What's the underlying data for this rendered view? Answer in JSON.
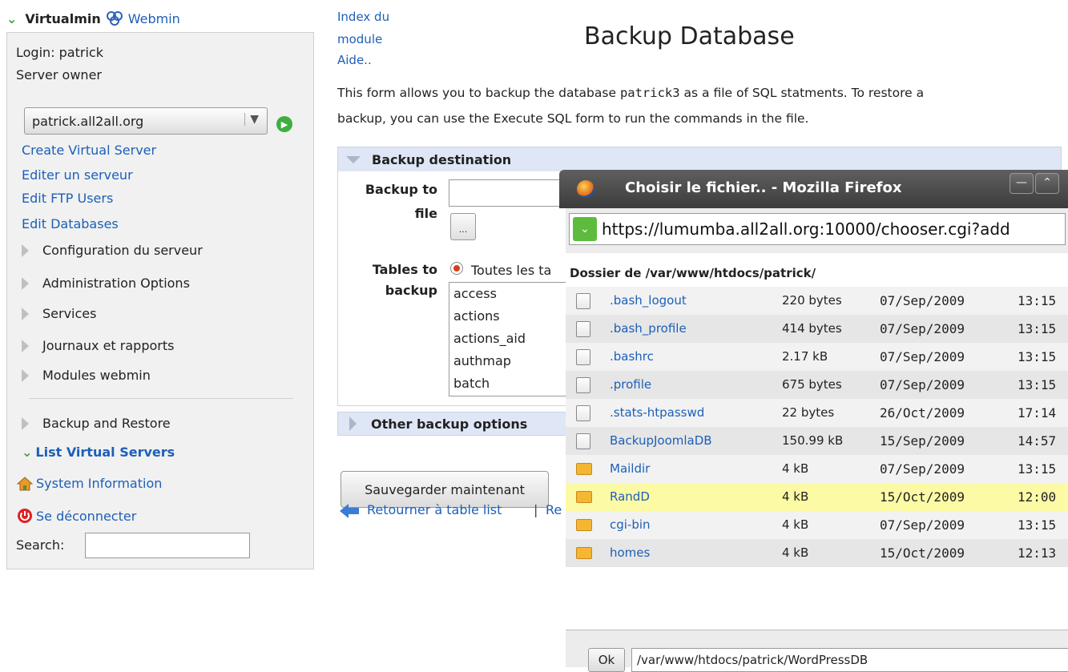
{
  "topnav": {
    "virtualmin": "Virtualmin",
    "webmin": "Webmin"
  },
  "sidebar": {
    "login": "Login: patrick",
    "role": "Server owner",
    "server_select": "patrick.all2all.org",
    "links": [
      "Create Virtual Server",
      "Editer un serveur",
      "Edit FTP Users",
      "Edit Databases"
    ],
    "categories": [
      "Configuration du serveur",
      "Administration Options",
      "Services",
      "Journaux et rapports",
      "Modules webmin"
    ],
    "backup_restore": "Backup and Restore",
    "list_virtual_servers": "List Virtual Servers",
    "system_information": "System Information",
    "logout": "Se déconnecter",
    "search_label": "Search:"
  },
  "main": {
    "index_line1": "Index du",
    "index_line2": "module",
    "help": "Aide..",
    "title": "Backup Database",
    "intro_before": "This form allows you to backup the database ",
    "intro_db": "patrick3",
    "intro_after": " as a file of SQL statments. To restore a",
    "intro_line2": "backup, you can use the Execute SQL form to run the commands in the file.",
    "section_destination": "Backup destination",
    "backup_to_line1": "Backup to",
    "backup_to_line2": "file",
    "browse": "...",
    "tables_line1": "Tables to",
    "tables_line2": "backup",
    "radio_all": "Toutes les ta",
    "tables": [
      "access",
      "actions",
      "actions_aid",
      "authmap",
      "batch"
    ],
    "section_other": "Other backup options",
    "save_button": "Sauvegarder maintenant",
    "return_link": "Retourner à table list",
    "separator": "|",
    "return_more": "Re"
  },
  "firefox": {
    "title": "Choisir le fichier.. - Mozilla Firefox",
    "url": "https://lumumba.all2all.org:10000/chooser.cgi?add",
    "folder": "Dossier de /var/www/htdocs/patrick/",
    "files": [
      {
        "name": ".bash_logout",
        "size": "220 bytes",
        "date": "07/Sep/2009",
        "time": "13:15",
        "type": "file"
      },
      {
        "name": ".bash_profile",
        "size": "414 bytes",
        "date": "07/Sep/2009",
        "time": "13:15",
        "type": "file"
      },
      {
        "name": ".bashrc",
        "size": "2.17 kB",
        "date": "07/Sep/2009",
        "time": "13:15",
        "type": "file"
      },
      {
        "name": ".profile",
        "size": "675 bytes",
        "date": "07/Sep/2009",
        "time": "13:15",
        "type": "file"
      },
      {
        "name": ".stats-htpasswd",
        "size": "22 bytes",
        "date": "26/Oct/2009",
        "time": "17:14",
        "type": "file"
      },
      {
        "name": "BackupJoomlaDB",
        "size": "150.99 kB",
        "date": "15/Sep/2009",
        "time": "14:57",
        "type": "file"
      },
      {
        "name": "Maildir",
        "size": "4 kB",
        "date": "07/Sep/2009",
        "time": "13:15",
        "type": "folder"
      },
      {
        "name": "RandD",
        "size": "4 kB",
        "date": "15/Oct/2009",
        "time": "12:00",
        "type": "folder",
        "highlighted": true
      },
      {
        "name": "cgi-bin",
        "size": "4 kB",
        "date": "07/Sep/2009",
        "time": "13:15",
        "type": "folder"
      },
      {
        "name": "homes",
        "size": "4 kB",
        "date": "15/Oct/2009",
        "time": "12:13",
        "type": "folder"
      }
    ],
    "ok_button": "Ok",
    "path_value": "/var/www/htdocs/patrick/WordPressDB"
  },
  "colors": {
    "link": "#1d5fb8",
    "section_header": "#dfe6f6",
    "highlight_row": "#fdfaa6",
    "check_green": "#3aa63a"
  },
  "icons": [
    "webmin-icon",
    "go-icon",
    "chevron-right-icon",
    "home-icon",
    "power-icon",
    "back-arrow-icon",
    "firefox-icon",
    "secure-site-icon",
    "file-icon",
    "folder-icon"
  ]
}
